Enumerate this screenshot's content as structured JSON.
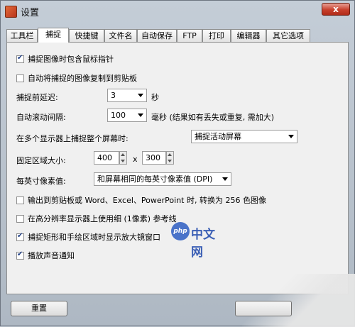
{
  "window": {
    "title": "设置",
    "close_label": "x"
  },
  "tabs": [
    "工具栏",
    "捕捉",
    "快捷键",
    "文件名",
    "自动保存",
    "FTP",
    "打印",
    "编辑器",
    "其它选项"
  ],
  "options": {
    "include_cursor": "捕捉图像时包含鼠标指针",
    "auto_copy": "自动将捕捉的图像复制到剪贴板",
    "delay_label": "捕捉前延迟:",
    "delay_value": "3",
    "delay_unit": "秒",
    "scroll_label": "自动滚动间隔:",
    "scroll_value": "100",
    "scroll_unit": "毫秒 (结果如有丢失或重复, 需加大)",
    "multi_monitor_label": "在多个显示器上捕捉整个屏幕时:",
    "multi_monitor_value": "捕捉活动屏幕",
    "fixed_area_label": "固定区域大小:",
    "fixed_width": "400",
    "fixed_x": "x",
    "fixed_height": "300",
    "dpi_label": "每英寸像素值:",
    "dpi_value": "和屏幕相同的每英寸像素值 (DPI)",
    "convert_256": "输出到剪贴板或 Word、Excel、PowerPoint 时, 转换为 256 色图像",
    "thin_line": "在高分辨率显示器上使用细 (1像素) 参考线",
    "magnifier": "捕捉矩形和手绘区域时显示放大镜窗口",
    "sound": "播放声音通知"
  },
  "checks": {
    "include_cursor": true,
    "auto_copy": false,
    "convert_256": false,
    "thin_line": false,
    "magnifier": true,
    "sound": true
  },
  "buttons": {
    "reset": "重置"
  },
  "watermark": {
    "logo": "php",
    "text": "中文网"
  }
}
